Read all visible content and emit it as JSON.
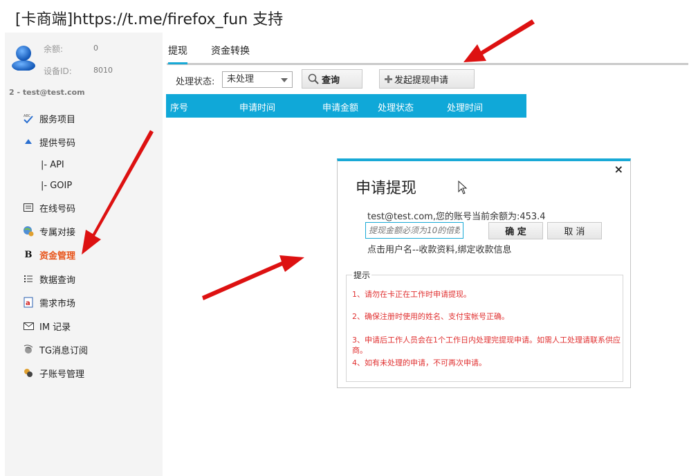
{
  "window": {
    "title": "[卡商端]https://t.me/firefox_fun 支持"
  },
  "sidebar": {
    "balance_label": "余额:",
    "balance_value": "0",
    "device_label": "设备ID:",
    "device_value": "8010",
    "account": "2 - test@test.com",
    "items": [
      {
        "label": "服务项目",
        "icon": "abc-check-icon"
      },
      {
        "label": "提供号码",
        "icon": "triangle-up-icon"
      },
      {
        "label": "|- API",
        "icon": ""
      },
      {
        "label": "|- GOIP",
        "icon": ""
      },
      {
        "label": "在线号码",
        "icon": "list-box-icon"
      },
      {
        "label": "专属对接",
        "icon": "globe-person-icon"
      },
      {
        "label": "资金管理",
        "icon": "bold-b-icon",
        "active": true
      },
      {
        "label": "数据查询",
        "icon": "list-icon"
      },
      {
        "label": "需求市场",
        "icon": "document-icon"
      },
      {
        "label": "IM 记录",
        "icon": "mail-icon"
      },
      {
        "label": "TG消息订阅",
        "icon": "satellite-icon"
      },
      {
        "label": "子账号管理",
        "icon": "users-icon"
      }
    ]
  },
  "tabs": [
    {
      "label": "提现",
      "active": true
    },
    {
      "label": "资金转换"
    }
  ],
  "filter": {
    "label": "处理状态:",
    "selected": "未处理",
    "query_button": "查询",
    "apply_button": "发起提现申请"
  },
  "table": {
    "columns": [
      "序号",
      "申请时间",
      "申请金额",
      "处理状态",
      "处理时间"
    ]
  },
  "dialog": {
    "title": "申请提现",
    "close": "×",
    "account_line": "test@test.com,您的账号当前余额为:453.4",
    "amount_placeholder": "提现金额必须为10的倍数",
    "ok_button": "确 定",
    "cancel_button": "取 消",
    "link": "点击用户名--收款资料,绑定收款信息",
    "tips_title": "提示",
    "tips": [
      "1、请勿在卡正在工作时申请提现。",
      "2、确保注册时使用的姓名、支付宝帐号正确。",
      "3、申请后工作人员会在1个工作日内处理完提现申请。如需人工处理请联系供应商。",
      "4、如有未处理的申请，不可再次申请。"
    ]
  },
  "colors": {
    "accent": "#18a9d6",
    "header": "#10a8d8",
    "active_menu": "#e8541a",
    "tip_text": "#e03030",
    "arrow": "#dd1111"
  }
}
